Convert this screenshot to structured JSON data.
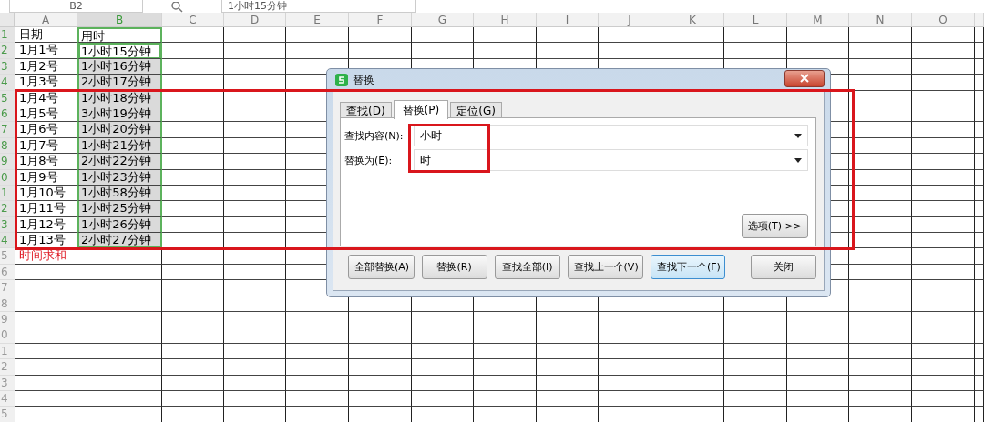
{
  "formula_bar": {
    "name_box": "B2",
    "formula": "1小时15分钟"
  },
  "columns": [
    {
      "label": "A",
      "selected": false
    },
    {
      "label": "B",
      "selected": true
    },
    {
      "label": "C",
      "selected": false
    },
    {
      "label": "D",
      "selected": false
    },
    {
      "label": "E",
      "selected": false
    },
    {
      "label": "F",
      "selected": false
    },
    {
      "label": "G",
      "selected": false
    },
    {
      "label": "H",
      "selected": false
    },
    {
      "label": "I",
      "selected": false
    },
    {
      "label": "J",
      "selected": false
    },
    {
      "label": "K",
      "selected": false
    },
    {
      "label": "L",
      "selected": false
    },
    {
      "label": "M",
      "selected": false
    },
    {
      "label": "N",
      "selected": false
    },
    {
      "label": "O",
      "selected": false
    }
  ],
  "rows": [
    {
      "number": "1",
      "selected": true,
      "cells": [
        {
          "text": "日期",
          "selected": false
        },
        {
          "text": "用时",
          "selected": false
        }
      ]
    },
    {
      "number": "2",
      "selected": true,
      "cells": [
        {
          "text": "1月1号",
          "selected": false
        },
        {
          "text": "1小时15分钟",
          "selected": false,
          "active": true
        }
      ]
    },
    {
      "number": "3",
      "selected": true,
      "cells": [
        {
          "text": "1月2号",
          "selected": false
        },
        {
          "text": "1小时16分钟",
          "selected": true
        }
      ]
    },
    {
      "number": "4",
      "selected": true,
      "cells": [
        {
          "text": "1月3号",
          "selected": false
        },
        {
          "text": "2小时17分钟",
          "selected": true
        }
      ]
    },
    {
      "number": "5",
      "selected": true,
      "cells": [
        {
          "text": "1月4号",
          "selected": false
        },
        {
          "text": "1小时18分钟",
          "selected": true
        }
      ]
    },
    {
      "number": "6",
      "selected": true,
      "cells": [
        {
          "text": "1月5号",
          "selected": false
        },
        {
          "text": "3小时19分钟",
          "selected": true
        }
      ]
    },
    {
      "number": "7",
      "selected": true,
      "cells": [
        {
          "text": "1月6号",
          "selected": false
        },
        {
          "text": "1小时20分钟",
          "selected": true
        }
      ]
    },
    {
      "number": "8",
      "selected": true,
      "cells": [
        {
          "text": "1月7号",
          "selected": false
        },
        {
          "text": "1小时21分钟",
          "selected": true
        }
      ]
    },
    {
      "number": "9",
      "selected": true,
      "cells": [
        {
          "text": "1月8号",
          "selected": false
        },
        {
          "text": "2小时22分钟",
          "selected": true
        }
      ]
    },
    {
      "number": "0",
      "selected": true,
      "cells": [
        {
          "text": "1月9号",
          "selected": false
        },
        {
          "text": "1小时23分钟",
          "selected": true
        }
      ]
    },
    {
      "number": "1",
      "selected": true,
      "cells": [
        {
          "text": "1月10号",
          "selected": false
        },
        {
          "text": "1小时58分钟",
          "selected": true
        }
      ]
    },
    {
      "number": "2",
      "selected": true,
      "cells": [
        {
          "text": "1月11号",
          "selected": false
        },
        {
          "text": "1小时25分钟",
          "selected": true
        }
      ]
    },
    {
      "number": "3",
      "selected": true,
      "cells": [
        {
          "text": "1月12号",
          "selected": false
        },
        {
          "text": "1小时26分钟",
          "selected": true
        }
      ]
    },
    {
      "number": "4",
      "selected": true,
      "cells": [
        {
          "text": "1月13号",
          "selected": false
        },
        {
          "text": "2小时27分钟",
          "selected": true
        }
      ]
    },
    {
      "number": "5",
      "selected": false,
      "cells": [
        {
          "text": "时间求和",
          "selected": false,
          "color": "#e0202a"
        }
      ]
    },
    {
      "number": "6",
      "selected": false
    },
    {
      "number": "7",
      "selected": false
    },
    {
      "number": "8",
      "selected": false
    },
    {
      "number": "9",
      "selected": false
    },
    {
      "number": "0",
      "selected": false
    },
    {
      "number": "1",
      "selected": false
    },
    {
      "number": "2",
      "selected": false
    },
    {
      "number": "3",
      "selected": false
    },
    {
      "number": "4",
      "selected": false
    },
    {
      "number": "5",
      "selected": false
    }
  ],
  "dialog": {
    "title": "替换",
    "tabs": [
      {
        "label": "查找(D)",
        "selected": false
      },
      {
        "label": "替换(P)",
        "selected": true
      },
      {
        "label": "定位(G)",
        "selected": false
      }
    ],
    "fields": [
      {
        "label": "查找内容(N):",
        "value": "小时"
      },
      {
        "label": "替换为(E):",
        "value": "时"
      }
    ],
    "options_button": "选项(T) >>",
    "buttons": [
      {
        "label": "全部替换(A)",
        "focused": false
      },
      {
        "label": "替换(R)",
        "focused": false
      },
      {
        "label": "查找全部(I)",
        "focused": false
      },
      {
        "label": "查找上一个(V)",
        "focused": false
      },
      {
        "label": "查找下一个(F)",
        "focused": true
      },
      {
        "label": "关闭",
        "focused": false
      }
    ]
  }
}
